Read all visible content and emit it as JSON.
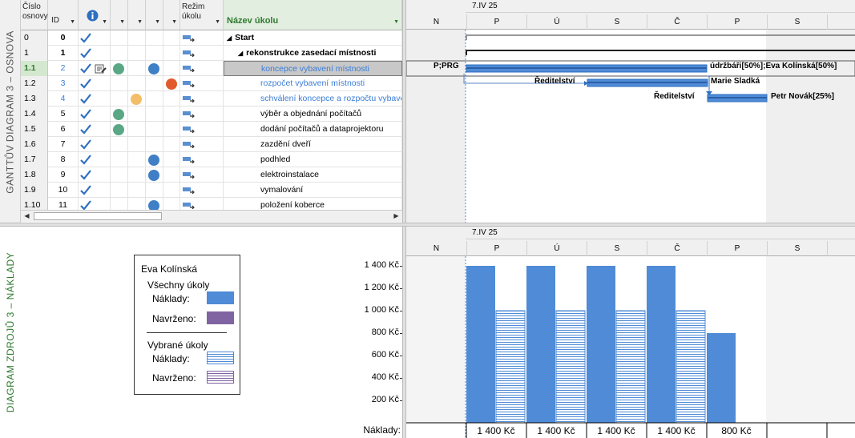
{
  "views": {
    "top_label": "GANTTŮV DIAGRAM 3 – OSNOVA",
    "bottom_label": "DIAGRAM ZDROJŮ 3 – NÁKLADY"
  },
  "columns": {
    "outline": "Číslo osnovy",
    "id": "ID",
    "info_icon": "info-icon",
    "mode": "Režim úkolu",
    "name": "Název úkolu"
  },
  "colors": {
    "accent_green": "#2d7a2d",
    "task_blue": "#2e6fc0",
    "link_blue": "#3b7dd8",
    "dot_green": "#5aa786",
    "dot_blue": "#3f7fc6",
    "dot_red": "#e05a2e",
    "dot_yellow": "#f3be6a",
    "bar_fill": "#4f8bd6",
    "proposed": "#8064a2"
  },
  "tasks": [
    {
      "outline": "0",
      "id": "0",
      "name": "Start",
      "bold": true,
      "indent": 0,
      "summary": true,
      "dots": []
    },
    {
      "outline": "1",
      "id": "1",
      "name": "rekonstrukce zasedací místnosti",
      "bold": true,
      "indent": 1,
      "summary": true,
      "dots": []
    },
    {
      "outline": "1.1",
      "id": "2",
      "name": "koncepce vybavení místnosti",
      "indent": 2,
      "selected": true,
      "link": true,
      "dots": [
        {
          "col": 2,
          "color": "dot_green"
        },
        {
          "col": 4,
          "color": "dot_blue"
        }
      ],
      "edit_icon": true
    },
    {
      "outline": "1.2",
      "id": "3",
      "name": "rozpočet vybavení místnosti",
      "indent": 2,
      "link": true,
      "dots": [
        {
          "col": 5,
          "color": "dot_red"
        }
      ]
    },
    {
      "outline": "1.3",
      "id": "4",
      "name": "schválení koncepce a rozpočtu vybavení",
      "indent": 2,
      "link": true,
      "dots": [
        {
          "col": 3,
          "color": "dot_yellow"
        }
      ]
    },
    {
      "outline": "1.4",
      "id": "5",
      "name": "výběr a objednání počítačů",
      "indent": 2,
      "dots": [
        {
          "col": 2,
          "color": "dot_green"
        }
      ]
    },
    {
      "outline": "1.5",
      "id": "6",
      "name": "dodání počítačů a dataprojektoru",
      "indent": 2,
      "dots": [
        {
          "col": 2,
          "color": "dot_green"
        }
      ]
    },
    {
      "outline": "1.6",
      "id": "7",
      "name": "zazdění dveří",
      "indent": 2,
      "dots": []
    },
    {
      "outline": "1.7",
      "id": "8",
      "name": "podhled",
      "indent": 2,
      "dots": [
        {
          "col": 4,
          "color": "dot_blue"
        }
      ]
    },
    {
      "outline": "1.8",
      "id": "9",
      "name": "elektroinstalace",
      "indent": 2,
      "dots": [
        {
          "col": 4,
          "color": "dot_blue"
        }
      ]
    },
    {
      "outline": "1.9",
      "id": "10",
      "name": "vymalování",
      "indent": 2,
      "dots": []
    },
    {
      "outline": "1.10",
      "id": "11",
      "name": "položení koberce",
      "indent": 2,
      "dots": [
        {
          "col": 4,
          "color": "dot_blue"
        }
      ]
    }
  ],
  "timescale": {
    "date": "7.IV 25",
    "days": [
      "N",
      "P",
      "Ú",
      "S",
      "Č",
      "P",
      "S",
      "N"
    ]
  },
  "gantt_labels": {
    "row2_left": "P;PRG",
    "row2_right": "údržbáři[50%];Eva Kolínská[50%]",
    "row3_left": "Ředitelství",
    "row3_right": "Marie Sladká",
    "row4_left": "Ředitelství",
    "row4_right": "Petr Novák[25%]"
  },
  "legend": {
    "resource": "Eva Kolínská",
    "all_tasks": "Všechny úkoly",
    "cost": "Náklady:",
    "proposed": "Navrženo:",
    "selected_tasks": "Vybrané úkoly",
    "cost2": "Náklady:",
    "proposed2": "Navrženo:"
  },
  "chart_data": {
    "type": "bar",
    "ylabel": "",
    "y_ticks": [
      "1 400 Kč",
      "1 200 Kč",
      "1 000 Kč",
      "800 Kč",
      "600 Kč",
      "400 Kč",
      "200 Kč"
    ],
    "ylim": [
      0,
      1400
    ],
    "categories": [
      "N",
      "P",
      "Ú",
      "S",
      "Č",
      "P",
      "S",
      "N"
    ],
    "series": [
      {
        "name": "Náklady",
        "values": [
          0,
          1400,
          1400,
          1400,
          1400,
          800,
          0,
          0
        ]
      },
      {
        "name": "Vybrané úkoly",
        "values": [
          0,
          1000,
          1000,
          1000,
          1000,
          0,
          0,
          0
        ]
      }
    ],
    "table_label": "Náklady:",
    "table_values": [
      "",
      "1 400 Kč",
      "1 400 Kč",
      "1 400 Kč",
      "1 400 Kč",
      "800 Kč",
      "",
      ""
    ]
  }
}
